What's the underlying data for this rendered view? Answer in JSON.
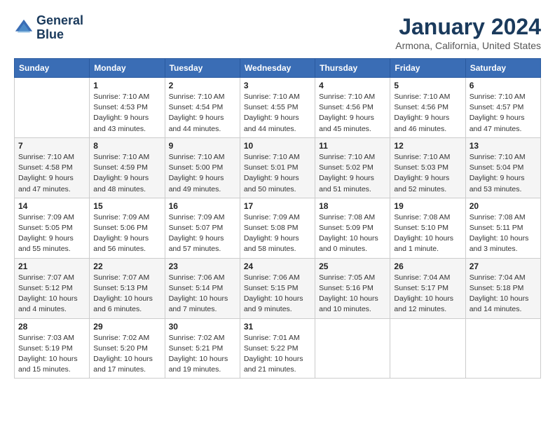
{
  "logo": {
    "line1": "General",
    "line2": "Blue"
  },
  "title": "January 2024",
  "subtitle": "Armona, California, United States",
  "headers": [
    "Sunday",
    "Monday",
    "Tuesday",
    "Wednesday",
    "Thursday",
    "Friday",
    "Saturday"
  ],
  "weeks": [
    [
      {
        "day": "",
        "info": ""
      },
      {
        "day": "1",
        "info": "Sunrise: 7:10 AM\nSunset: 4:53 PM\nDaylight: 9 hours\nand 43 minutes."
      },
      {
        "day": "2",
        "info": "Sunrise: 7:10 AM\nSunset: 4:54 PM\nDaylight: 9 hours\nand 44 minutes."
      },
      {
        "day": "3",
        "info": "Sunrise: 7:10 AM\nSunset: 4:55 PM\nDaylight: 9 hours\nand 44 minutes."
      },
      {
        "day": "4",
        "info": "Sunrise: 7:10 AM\nSunset: 4:56 PM\nDaylight: 9 hours\nand 45 minutes."
      },
      {
        "day": "5",
        "info": "Sunrise: 7:10 AM\nSunset: 4:56 PM\nDaylight: 9 hours\nand 46 minutes."
      },
      {
        "day": "6",
        "info": "Sunrise: 7:10 AM\nSunset: 4:57 PM\nDaylight: 9 hours\nand 47 minutes."
      }
    ],
    [
      {
        "day": "7",
        "info": "Sunrise: 7:10 AM\nSunset: 4:58 PM\nDaylight: 9 hours\nand 47 minutes."
      },
      {
        "day": "8",
        "info": "Sunrise: 7:10 AM\nSunset: 4:59 PM\nDaylight: 9 hours\nand 48 minutes."
      },
      {
        "day": "9",
        "info": "Sunrise: 7:10 AM\nSunset: 5:00 PM\nDaylight: 9 hours\nand 49 minutes."
      },
      {
        "day": "10",
        "info": "Sunrise: 7:10 AM\nSunset: 5:01 PM\nDaylight: 9 hours\nand 50 minutes."
      },
      {
        "day": "11",
        "info": "Sunrise: 7:10 AM\nSunset: 5:02 PM\nDaylight: 9 hours\nand 51 minutes."
      },
      {
        "day": "12",
        "info": "Sunrise: 7:10 AM\nSunset: 5:03 PM\nDaylight: 9 hours\nand 52 minutes."
      },
      {
        "day": "13",
        "info": "Sunrise: 7:10 AM\nSunset: 5:04 PM\nDaylight: 9 hours\nand 53 minutes."
      }
    ],
    [
      {
        "day": "14",
        "info": "Sunrise: 7:09 AM\nSunset: 5:05 PM\nDaylight: 9 hours\nand 55 minutes."
      },
      {
        "day": "15",
        "info": "Sunrise: 7:09 AM\nSunset: 5:06 PM\nDaylight: 9 hours\nand 56 minutes."
      },
      {
        "day": "16",
        "info": "Sunrise: 7:09 AM\nSunset: 5:07 PM\nDaylight: 9 hours\nand 57 minutes."
      },
      {
        "day": "17",
        "info": "Sunrise: 7:09 AM\nSunset: 5:08 PM\nDaylight: 9 hours\nand 58 minutes."
      },
      {
        "day": "18",
        "info": "Sunrise: 7:08 AM\nSunset: 5:09 PM\nDaylight: 10 hours\nand 0 minutes."
      },
      {
        "day": "19",
        "info": "Sunrise: 7:08 AM\nSunset: 5:10 PM\nDaylight: 10 hours\nand 1 minute."
      },
      {
        "day": "20",
        "info": "Sunrise: 7:08 AM\nSunset: 5:11 PM\nDaylight: 10 hours\nand 3 minutes."
      }
    ],
    [
      {
        "day": "21",
        "info": "Sunrise: 7:07 AM\nSunset: 5:12 PM\nDaylight: 10 hours\nand 4 minutes."
      },
      {
        "day": "22",
        "info": "Sunrise: 7:07 AM\nSunset: 5:13 PM\nDaylight: 10 hours\nand 6 minutes."
      },
      {
        "day": "23",
        "info": "Sunrise: 7:06 AM\nSunset: 5:14 PM\nDaylight: 10 hours\nand 7 minutes."
      },
      {
        "day": "24",
        "info": "Sunrise: 7:06 AM\nSunset: 5:15 PM\nDaylight: 10 hours\nand 9 minutes."
      },
      {
        "day": "25",
        "info": "Sunrise: 7:05 AM\nSunset: 5:16 PM\nDaylight: 10 hours\nand 10 minutes."
      },
      {
        "day": "26",
        "info": "Sunrise: 7:04 AM\nSunset: 5:17 PM\nDaylight: 10 hours\nand 12 minutes."
      },
      {
        "day": "27",
        "info": "Sunrise: 7:04 AM\nSunset: 5:18 PM\nDaylight: 10 hours\nand 14 minutes."
      }
    ],
    [
      {
        "day": "28",
        "info": "Sunrise: 7:03 AM\nSunset: 5:19 PM\nDaylight: 10 hours\nand 15 minutes."
      },
      {
        "day": "29",
        "info": "Sunrise: 7:02 AM\nSunset: 5:20 PM\nDaylight: 10 hours\nand 17 minutes."
      },
      {
        "day": "30",
        "info": "Sunrise: 7:02 AM\nSunset: 5:21 PM\nDaylight: 10 hours\nand 19 minutes."
      },
      {
        "day": "31",
        "info": "Sunrise: 7:01 AM\nSunset: 5:22 PM\nDaylight: 10 hours\nand 21 minutes."
      },
      {
        "day": "",
        "info": ""
      },
      {
        "day": "",
        "info": ""
      },
      {
        "day": "",
        "info": ""
      }
    ]
  ]
}
